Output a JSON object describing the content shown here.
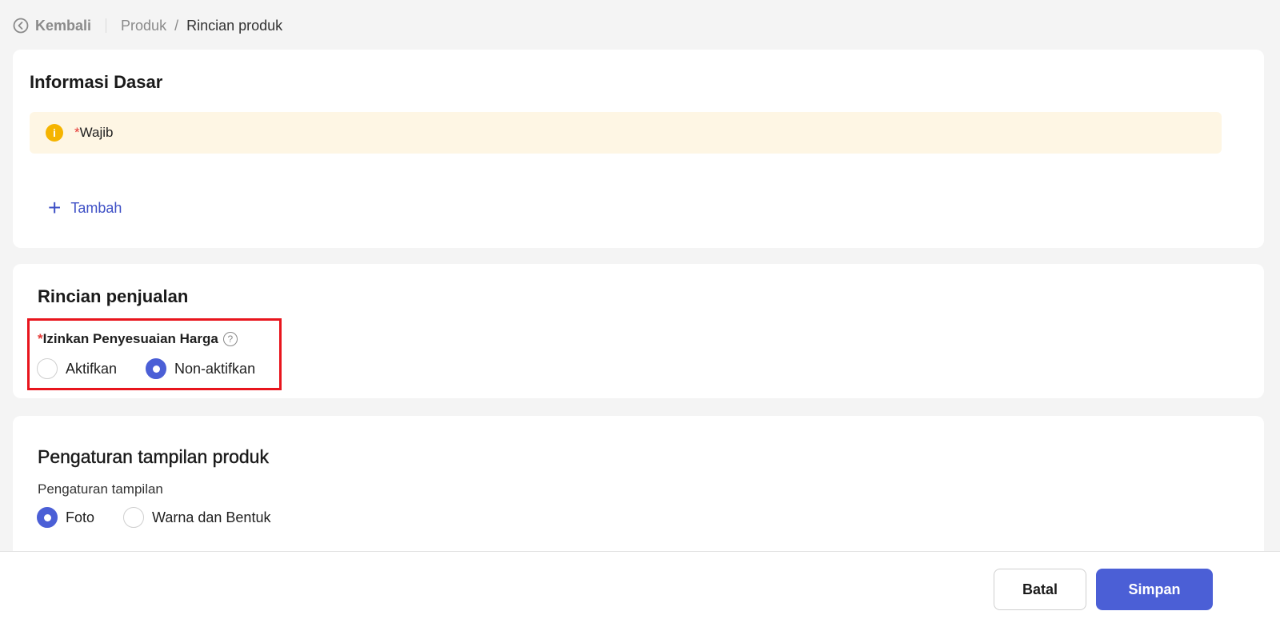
{
  "breadcrumb": {
    "back_label": "Kembali",
    "parent": "Produk",
    "separator": "/",
    "current": "Rincian produk"
  },
  "basic_info": {
    "title": "Informasi Dasar",
    "notice_required_mark": "*",
    "notice_text": "Wajib",
    "add_label": "Tambah"
  },
  "sales_details": {
    "title": "Rincian penjualan",
    "required_mark": "*",
    "field_label": "Izinkan Penyesuaian Harga",
    "options": [
      {
        "label": "Aktifkan",
        "selected": false
      },
      {
        "label": "Non-aktifkan",
        "selected": true
      }
    ]
  },
  "display_settings": {
    "title": "Pengaturan tampilan produk",
    "sub_label": "Pengaturan tampilan",
    "options": [
      {
        "label": "Foto",
        "selected": true
      },
      {
        "label": "Warna dan Bentuk",
        "selected": false
      }
    ]
  },
  "footer": {
    "cancel_label": "Batal",
    "save_label": "Simpan"
  },
  "colors": {
    "primary": "#4b5fd6",
    "required": "#e53935",
    "notice_bg": "#fef6e4",
    "highlight_border": "#e8151d"
  }
}
